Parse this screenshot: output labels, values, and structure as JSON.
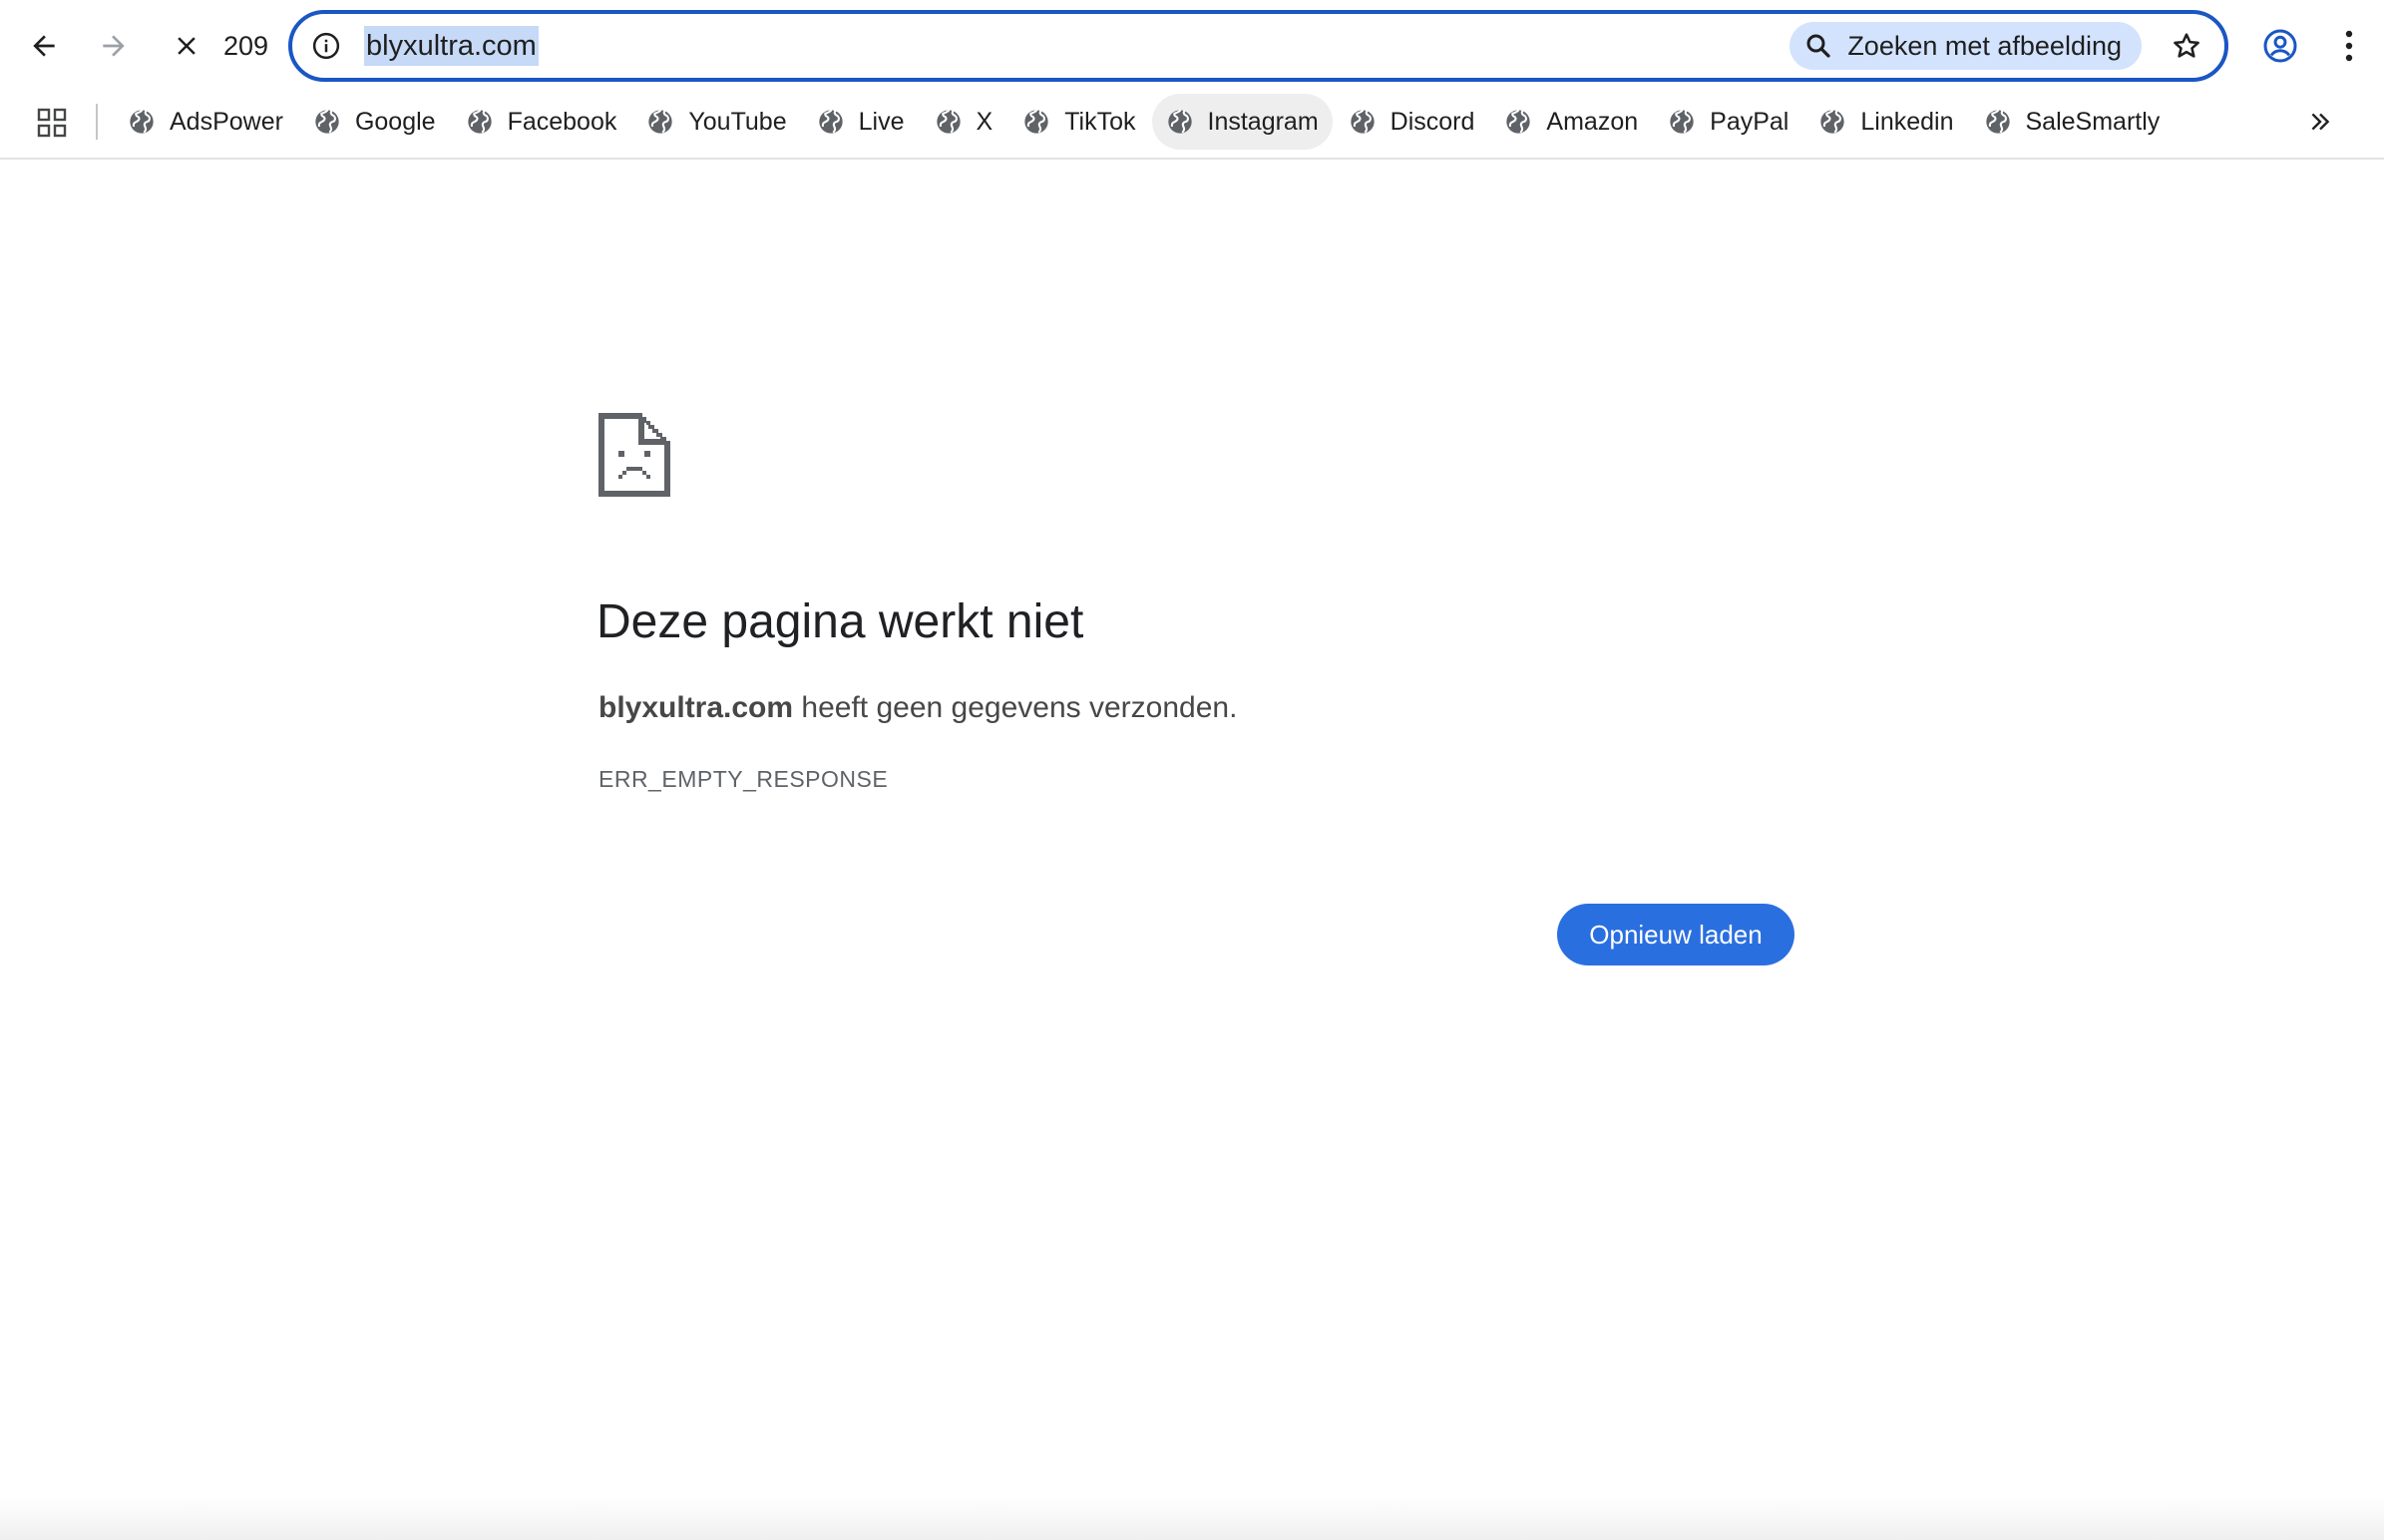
{
  "toolbar": {
    "back_icon": "arrow-left-icon",
    "forward_icon": "arrow-right-icon",
    "stop_icon": "close-icon",
    "count": "209",
    "url": "blyxultra.com",
    "site_info_icon": "info-icon",
    "lens_label": "Zoeken met afbeelding",
    "lens_icon": "search-icon",
    "bookmark_icon": "star-icon",
    "profile_icon": "account-circle-icon",
    "menu_icon": "more-vertical-icon",
    "accent_color": "#1a56c4"
  },
  "bookmarks": {
    "apps_icon": "grid-icon",
    "items": [
      {
        "label": "AdsPower"
      },
      {
        "label": "Google"
      },
      {
        "label": "Facebook"
      },
      {
        "label": "YouTube"
      },
      {
        "label": "Live"
      },
      {
        "label": "X"
      },
      {
        "label": "TikTok"
      },
      {
        "label": "Instagram"
      },
      {
        "label": "Discord"
      },
      {
        "label": "Amazon"
      },
      {
        "label": "PayPal"
      },
      {
        "label": "Linkedin"
      },
      {
        "label": "SaleSmartly"
      }
    ],
    "overflow_icon": "chevron-double-right-icon"
  },
  "error": {
    "icon": "sad-page-icon",
    "title": "Deze pagina werkt niet",
    "host": "blyxultra.com",
    "message": " heeft geen gegevens verzonden.",
    "code": "ERR_EMPTY_RESPONSE",
    "reload_label": "Opnieuw laden",
    "button_color": "#2a6fe0"
  }
}
